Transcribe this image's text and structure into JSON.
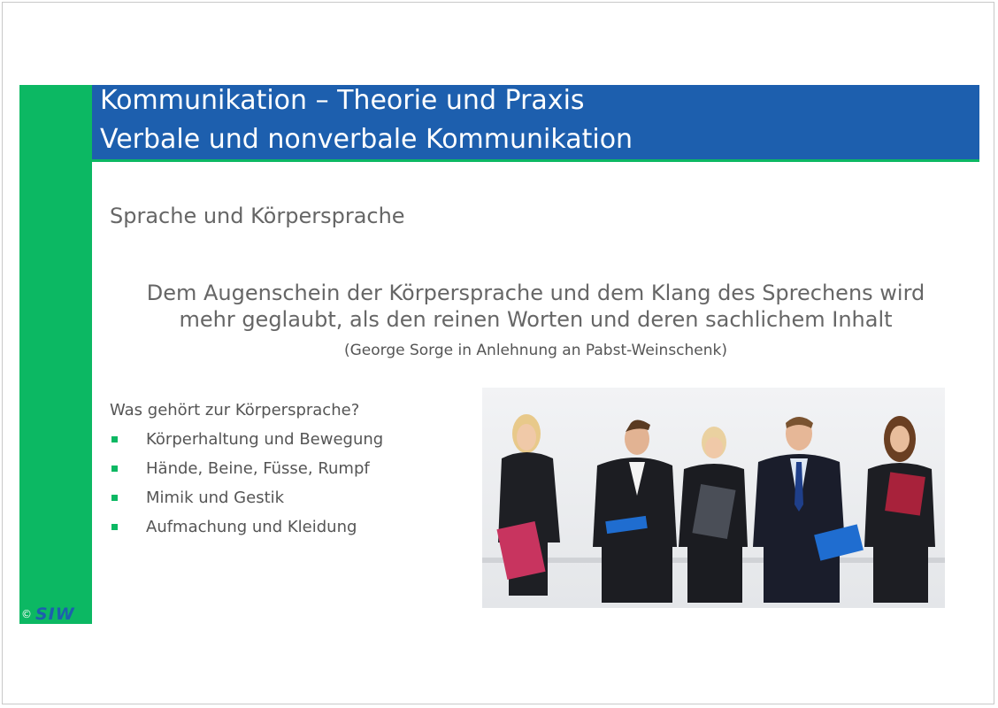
{
  "header": {
    "title_line1": "Kommunikation – Theorie und Praxis",
    "title_line2": "Verbale und nonverbale Kommunikation"
  },
  "content": {
    "subtitle": "Sprache und Körpersprache",
    "quote_line1": "Dem Augenschein der Körpersprache und dem Klang des Sprechens wird",
    "quote_line2": "mehr geglaubt, als den reinen Worten und deren sachlichem Inhalt",
    "source": "(George Sorge in Anlehnung an Pabst-Weinschenk)",
    "question": "Was gehört zur Körpersprache?",
    "bullets": [
      "Körperhaltung und Bewegung",
      "Hände, Beine, Füsse, Rumpf",
      "Mimik und Gestik",
      "Aufmachung und Kleidung"
    ]
  },
  "footer": {
    "copyright": "©",
    "logo": "SIW"
  },
  "colors": {
    "header_blue": "#1d5fae",
    "accent_green": "#0cb863",
    "text_gray": "#666666"
  }
}
